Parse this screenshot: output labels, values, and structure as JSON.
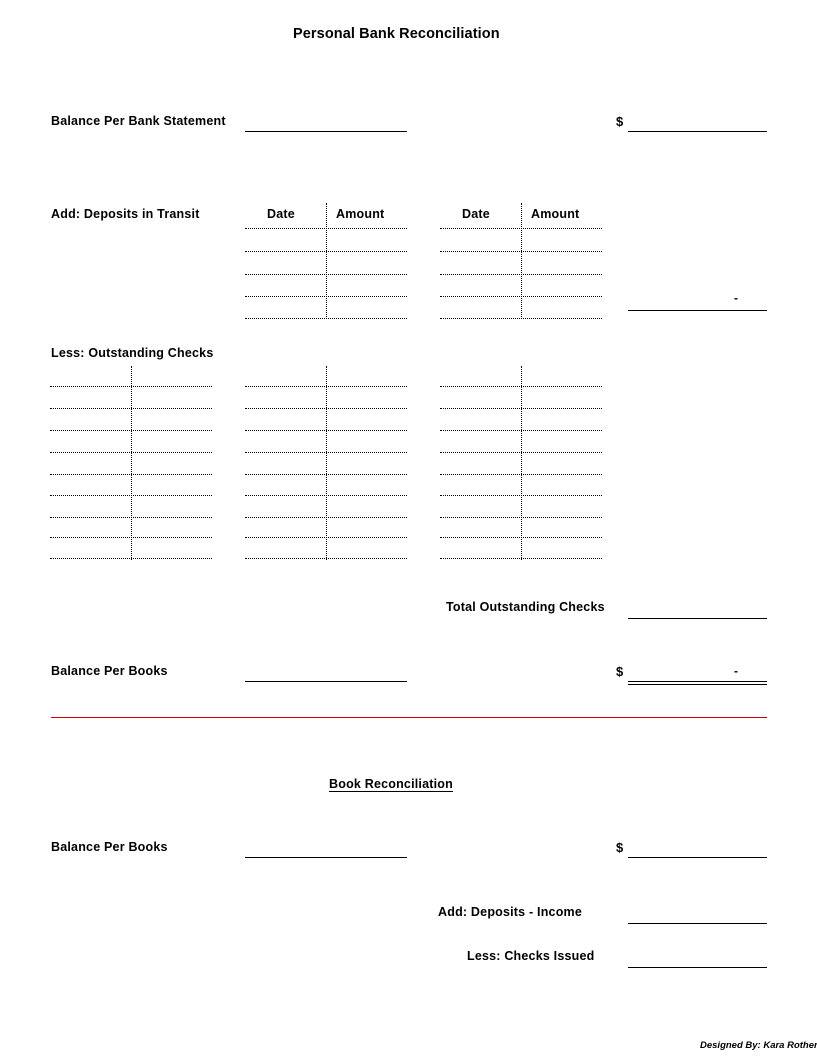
{
  "document": {
    "title": "Personal Bank Reconciliation",
    "credit": "Designed By:  Kara Rothert",
    "accent_red": "#CC0000"
  },
  "bank_reconciliation": {
    "balance_per_bank_label": "Balance Per Bank Statement",
    "balance_per_bank_currency": "$",
    "balance_per_bank_value": "",
    "deposits_in_transit_label": "Add:  Deposits in Transit",
    "deposits_tables": [
      {
        "headers": [
          "Date",
          "Amount"
        ],
        "rows": [
          [
            "",
            ""
          ],
          [
            "",
            ""
          ],
          [
            "",
            ""
          ],
          [
            "",
            ""
          ]
        ]
      },
      {
        "headers": [
          "Date",
          "Amount"
        ],
        "rows": [
          [
            "",
            ""
          ],
          [
            "",
            ""
          ],
          [
            "",
            ""
          ],
          [
            "",
            ""
          ]
        ]
      }
    ],
    "deposits_total_value": "-",
    "outstanding_checks_label": "Less:  Outstanding Checks",
    "outstanding_checks_columns": 3,
    "outstanding_checks_rows": 8,
    "total_outstanding_label": "Total Outstanding Checks",
    "total_outstanding_value": "",
    "balance_per_books_label": "Balance Per Books",
    "balance_per_books_currency": "$",
    "balance_per_books_value": "-"
  },
  "book_reconciliation": {
    "heading": "Book Reconciliation",
    "balance_per_books_label": "Balance Per Books",
    "balance_per_books_currency": "$",
    "balance_per_books_value": "",
    "deposits_income_label": "Add:  Deposits - Income",
    "deposits_income_value": "",
    "checks_issued_label": "Less:  Checks Issued",
    "checks_issued_value": ""
  }
}
